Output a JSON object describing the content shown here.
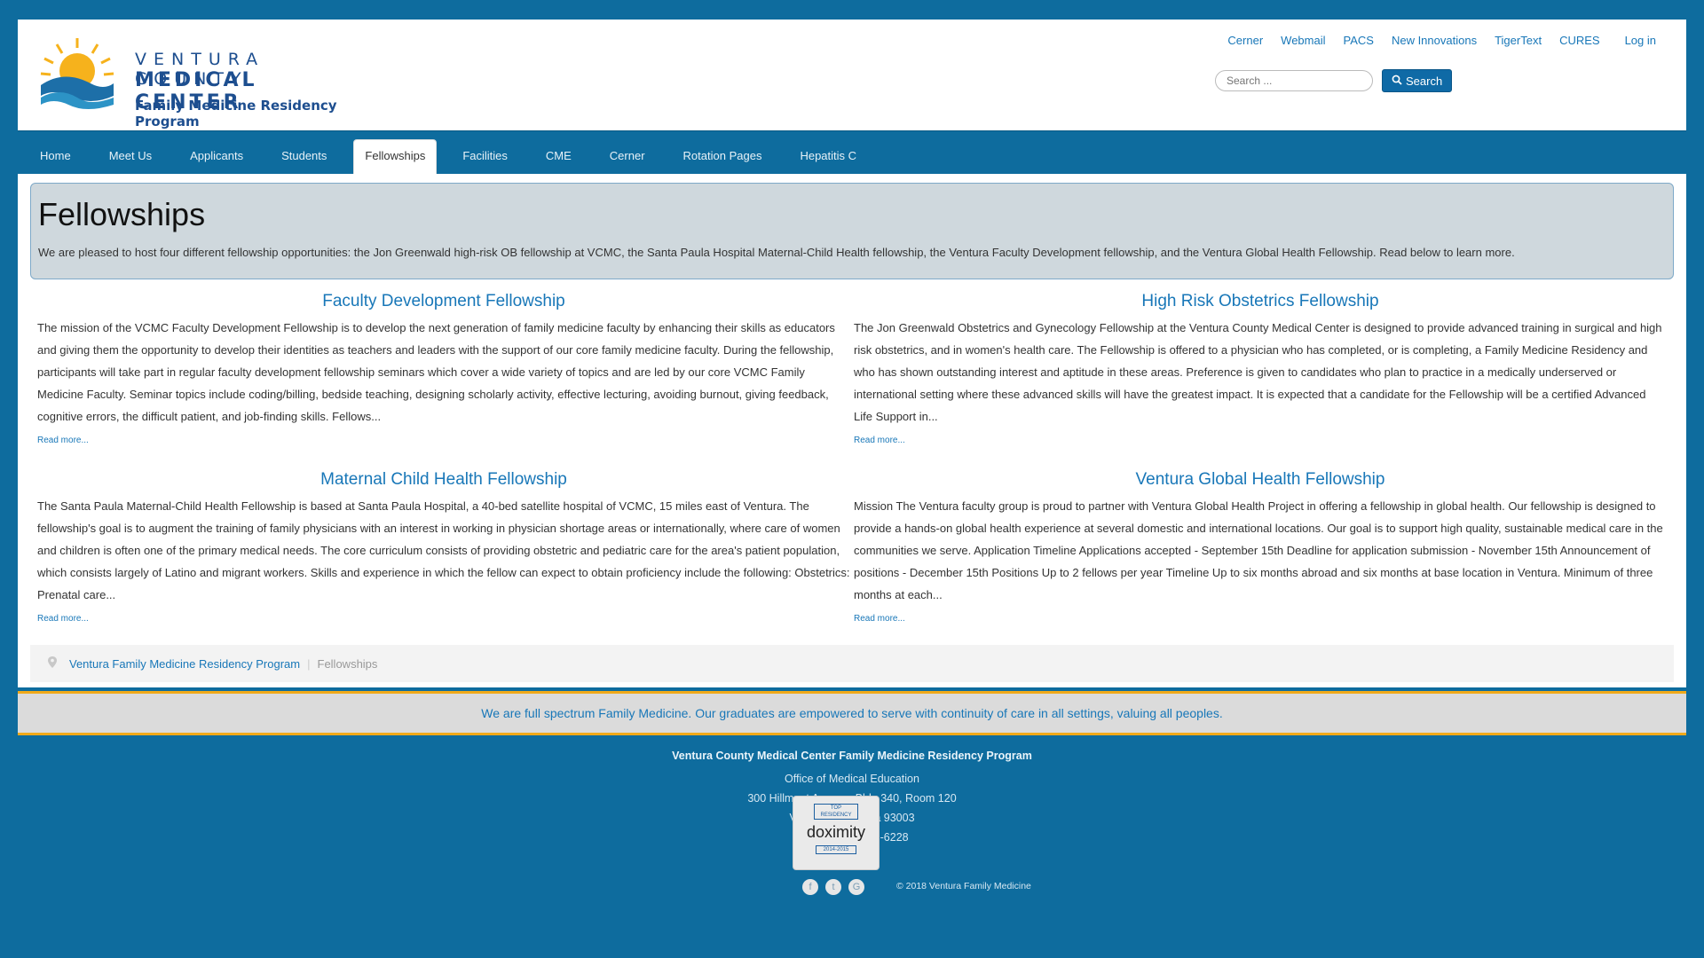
{
  "logo": {
    "line1": "VENTURA COUNTY",
    "line2": "MEDICAL CENTER",
    "line3": "Family Medicine Residency Program"
  },
  "toplinks": [
    "Cerner",
    "Webmail",
    "PACS",
    "New Innovations",
    "TigerText",
    "CURES"
  ],
  "login_label": "Log in",
  "search": {
    "placeholder": "Search ...",
    "button_label": "Search"
  },
  "nav": [
    "Home",
    "Meet Us",
    "Applicants",
    "Students",
    "Fellowships",
    "Facilities",
    "CME",
    "Cerner",
    "Rotation Pages",
    "Hepatitis C"
  ],
  "nav_active": "Fellowships",
  "hero": {
    "title": "Fellowships",
    "intro": "We are pleased to host four different fellowship opportunities: the Jon Greenwald high-risk OB fellowship at VCMC, the Santa Paula Hospital Maternal-Child Health fellowship, the Ventura Faculty Development fellowship, and the Ventura Global Health Fellowship.  Read below to learn more."
  },
  "cards": [
    {
      "title": "Faculty Development Fellowship",
      "text": "The mission of the VCMC Faculty Development Fellowship is to develop the next generation of family medicine faculty by enhancing their skills as educators and giving them the opportunity to develop their identities as teachers and leaders with the support of our core family medicine faculty.  During the fellowship, participants will take part in regular faculty development fellowship seminars which cover a wide variety of topics and are led by our core VCMC Family Medicine Faculty.  Seminar topics include coding/billing, bedside teaching, designing scholarly activity, effective lecturing, avoiding burnout, giving feedback, cognitive errors, the difficult patient, and job-finding skills. Fellows...",
      "more": "Read more..."
    },
    {
      "title": "High Risk Obstetrics Fellowship",
      "text": "The Jon Greenwald Obstetrics and Gynecology Fellowship at the Ventura County Medical Center is designed to provide advanced training in surgical and high risk obstetrics, and in women's health care. The Fellowship is offered to a physician who has completed, or is completing, a Family Medicine Residency and who has shown outstanding interest and aptitude in these areas. Preference is given to candidates who plan to practice in a medically underserved or international setting where these advanced skills will have the greatest impact. It is expected that a candidate for the Fellowship will be a certified Advanced Life Support in...",
      "more": "Read more..."
    },
    {
      "title": "Maternal Child Health Fellowship",
      "text": "The Santa Paula Maternal-Child Health Fellowship is based at Santa Paula Hospital, a 40-bed satellite hospital of VCMC, 15 miles east of Ventura. The fellowship's goal is to augment the training of family physicians with an interest in working in physician shortage areas or internationally, where care of women and children is often one of the primary medical needs. The core curriculum consists of providing obstetric and pediatric care for the area's patient population, which consists largely of Latino and migrant workers. Skills and experience in which the fellow can expect to obtain proficiency include the following: Obstetrics: Prenatal care...",
      "more": "Read more..."
    },
    {
      "title": "Ventura Global Health Fellowship",
      "text": "Mission The Ventura faculty group is proud to partner with Ventura Global Health Project in offering a fellowship in global health. Our fellowship is designed to provide a hands-on global health experience at several domestic and international locations. Our goal is to support high quality, sustainable medical care in the communities we serve. Application Timeline Applications accepted - September 15th Deadline for application submission - November 15th Announcement of positions - December 15th Positions Up to 2 fellows per year Timeline Up to six months abroad and six months at base location in Ventura. Minimum of three months at each...",
      "more": "Read more..."
    }
  ],
  "breadcrumb": {
    "home": "Ventura Family Medicine Residency Program",
    "current": "Fellowships",
    "separator": "|"
  },
  "banner": "We are full spectrum Family Medicine. Our graduates are empowered to serve with continuity of care in all settings, valuing all peoples.",
  "footer": {
    "name": "Ventura County Medical Center Family Medicine Residency Program",
    "office": "Office of Medical Education",
    "address": "300 Hillmont Avenue, Bldg 340, Room 120",
    "city": "Ventura, California 93003",
    "phone": "phone: (805) 652-6228"
  },
  "doximity": {
    "top": "TOP",
    "residency": "RESIDENCY",
    "brand": "doximity",
    "years": "2014-2015"
  },
  "social": [
    "f",
    "t",
    "G"
  ],
  "copyright": "© 2018 Ventura Family Medicine",
  "colors": {
    "brand_blue": "#0e6c9e",
    "link_blue": "#1877b8",
    "accent_gold": "#f0a919"
  }
}
